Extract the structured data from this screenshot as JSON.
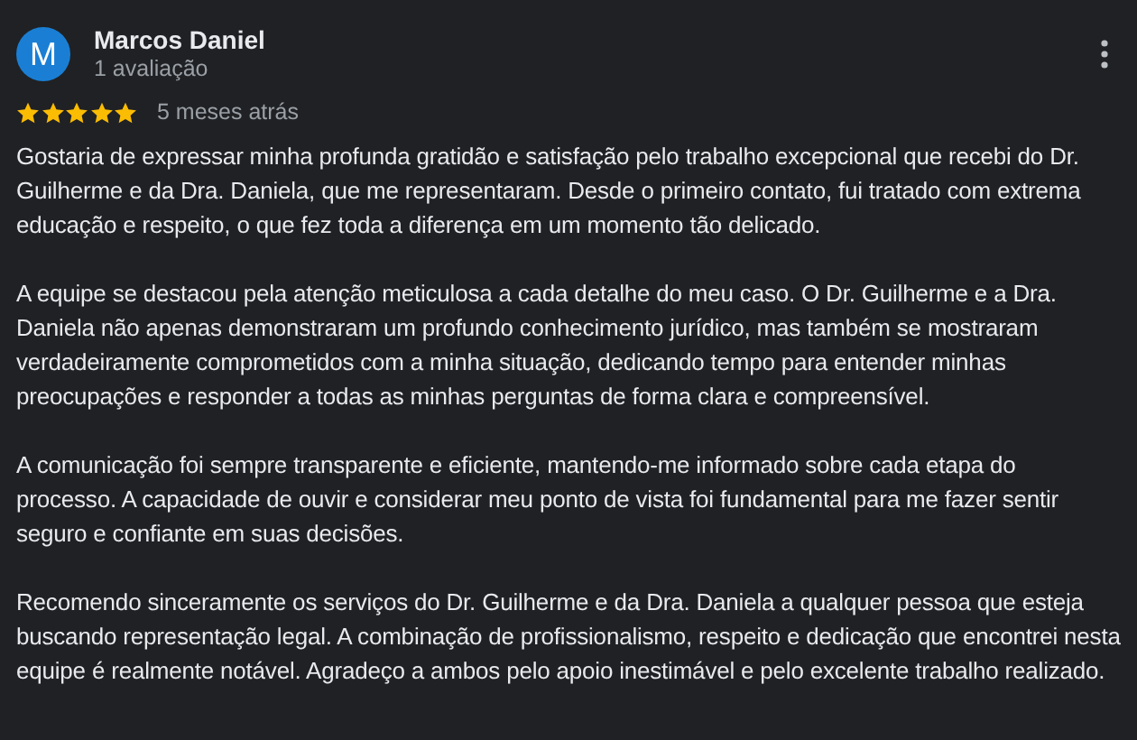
{
  "review": {
    "avatar_letter": "M",
    "author": "Marcos Daniel",
    "author_meta": "1 avaliação",
    "stars": 5,
    "time": "5 meses atrás",
    "paragraphs": [
      "Gostaria de expressar minha profunda gratidão e satisfação pelo trabalho excepcional que recebi do Dr. Guilherme e da Dra. Daniela, que me representaram. Desde o primeiro contato, fui tratado com extrema educação e respeito, o que fez toda a diferença em um momento tão delicado.",
      "A equipe se destacou pela atenção meticulosa a cada detalhe do meu caso. O Dr. Guilherme e a Dra. Daniela não apenas demonstraram um profundo conhecimento jurídico, mas também se mostraram verdadeiramente comprometidos com a minha situação, dedicando tempo para entender minhas preocupações e responder a todas as minhas perguntas de forma clara e compreensível.",
      "A comunicação foi sempre transparente e eficiente, mantendo-me informado sobre cada etapa do processo. A capacidade de ouvir e considerar meu ponto de vista foi fundamental para me fazer sentir seguro e confiante em suas decisões.",
      "Recomendo sinceramente os serviços do Dr. Guilherme e da Dra. Daniela a qualquer pessoa que esteja buscando representação legal. A combinação de profissionalismo, respeito e dedicação que encontrei nesta equipe é realmente notável. Agradeço a ambos pelo apoio inestimável e pelo excelente trabalho realizado."
    ]
  }
}
